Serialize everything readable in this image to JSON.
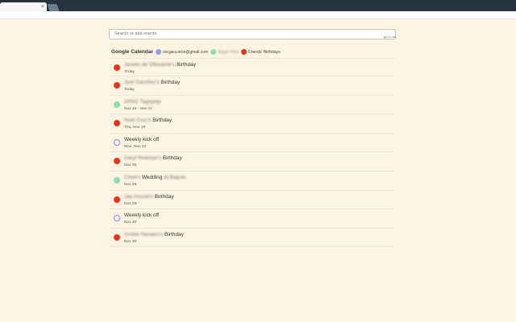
{
  "browser": {
    "tab_close": "×"
  },
  "app": {
    "search_placeholder": "Search or add events",
    "calendar_link": "go to cal",
    "legend": {
      "title": "Google Calendar",
      "calendars": [
        {
          "label": "vergara.eron@gmail.com",
          "color": "#8e9ff0",
          "blurred": false
        },
        {
          "label": "Biggie Holo",
          "color": "#8fdbb5",
          "blurred": true
        },
        {
          "label": "Friends' Birthdays",
          "color": "#e8341c",
          "blurred": false
        }
      ]
    },
    "events": [
      {
        "title_blur": "Jaswin de Villasante's",
        "title": "Birthday",
        "date": "Today",
        "color": "#e8341c",
        "hollow": false
      },
      {
        "title_blur": "Joel Sanchez's",
        "title": "Birthday",
        "date": "Today",
        "color": "#e8341c",
        "hollow": false
      },
      {
        "title_blur": "ARSC Tagaytay",
        "title": "",
        "date": "Nov 18 - Nov 21",
        "color": "#8fdbb5",
        "hollow": false
      },
      {
        "title_blur": "Noel Cruz's",
        "title": "Birthday",
        "date": "Thu, Nov 19",
        "color": "#e8341c",
        "hollow": false
      },
      {
        "title_blur": "",
        "title": "Weekly kick off",
        "date": "Mon, Nov 23",
        "color": "#8e7ff0",
        "hollow": true
      },
      {
        "title_blur": "Daryl Reamon's",
        "title": "Birthday",
        "date": "Nov 25",
        "color": "#e8341c",
        "hollow": false
      },
      {
        "title_blur": "Ched's",
        "title": "Wedding",
        "title_after_blur": "at Baguio",
        "date": "Nov 28",
        "color": "#8fdbb5",
        "hollow": false
      },
      {
        "title_blur": "Jay Ancuel's",
        "title": "Birthday",
        "date": "Nov 29",
        "color": "#e8341c",
        "hollow": false
      },
      {
        "title_blur": "",
        "title": "Weekly kick off",
        "date": "Nov 30",
        "color": "#8e7ff0",
        "hollow": true
      },
      {
        "title_blur": "Andrei Navarro's",
        "title": "Birthday",
        "date": "Nov 30",
        "color": "#e8341c",
        "hollow": false
      }
    ]
  }
}
